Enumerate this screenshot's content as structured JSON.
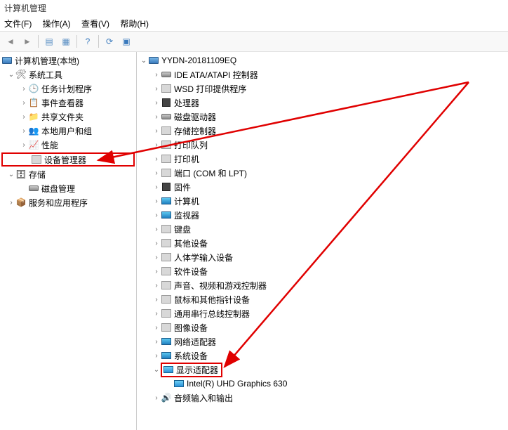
{
  "window": {
    "title": "计算机管理"
  },
  "menu": {
    "file": "文件(F)",
    "action": "操作(A)",
    "view": "查看(V)",
    "help": "帮助(H)"
  },
  "left_tree": {
    "root": "计算机管理(本地)",
    "system_tools": "系统工具",
    "task_scheduler": "任务计划程序",
    "event_viewer": "事件查看器",
    "shared_folders": "共享文件夹",
    "local_users": "本地用户和组",
    "performance": "性能",
    "device_manager": "设备管理器",
    "storage": "存储",
    "disk_management": "磁盘管理",
    "services_apps": "服务和应用程序"
  },
  "right_tree": {
    "root": "YYDN-20181109EQ",
    "ide": "IDE ATA/ATAPI 控制器",
    "wsd": "WSD 打印提供程序",
    "processors": "处理器",
    "disk_drives": "磁盘驱动器",
    "storage_controllers": "存储控制器",
    "print_queues": "打印队列",
    "printers": "打印机",
    "ports": "端口 (COM 和 LPT)",
    "firmware": "固件",
    "computer": "计算机",
    "monitors": "监视器",
    "keyboards": "键盘",
    "other_devices": "其他设备",
    "hid": "人体学输入设备",
    "software_devices": "软件设备",
    "sound": "声音、视频和游戏控制器",
    "mice": "鼠标和其他指针设备",
    "usb": "通用串行总线控制器",
    "imaging": "图像设备",
    "network": "网络适配器",
    "system_devices": "系统设备",
    "display_adapters": "显示适配器",
    "display_child": "Intel(R) UHD Graphics 630",
    "audio": "音频输入和输出"
  }
}
